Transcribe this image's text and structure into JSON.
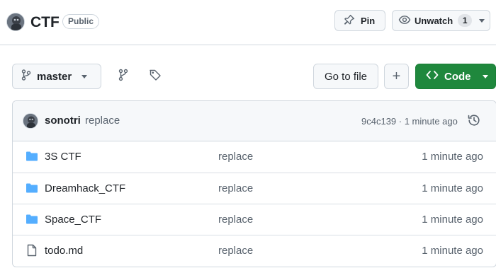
{
  "header": {
    "repo_name": "CTF",
    "visibility": "Public",
    "pin_label": "Pin",
    "watch_label": "Unwatch",
    "watch_count": "1"
  },
  "toolbar": {
    "branch": "master",
    "goto_label": "Go to file",
    "add_label": "+",
    "code_label": "Code"
  },
  "commit": {
    "author": "sonotri",
    "message": "replace",
    "meta": "9c4c139 · 1 minute ago"
  },
  "files": [
    {
      "name": "3S CTF",
      "type": "folder",
      "message": "replace",
      "time": "1 minute ago"
    },
    {
      "name": "Dreamhack_CTF",
      "type": "folder",
      "message": "replace",
      "time": "1 minute ago"
    },
    {
      "name": "Space_CTF",
      "type": "folder",
      "message": "replace",
      "time": "1 minute ago"
    },
    {
      "name": "todo.md",
      "type": "file",
      "message": "replace",
      "time": "1 minute ago"
    }
  ],
  "colors": {
    "accent_green": "#1f883d",
    "folder_blue": "#54aeff",
    "border": "#d0d7de",
    "muted_text": "#59636e"
  },
  "icons": [
    "avatar",
    "pin-icon",
    "eye-icon",
    "git-branch-icon",
    "branches-icon",
    "tag-icon",
    "code-icon",
    "history-icon",
    "folder-icon",
    "file-icon"
  ]
}
